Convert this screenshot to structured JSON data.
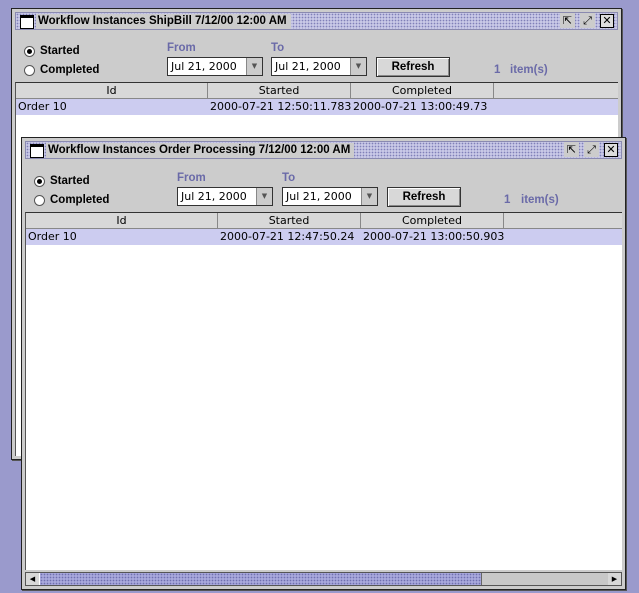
{
  "back_window": {
    "title": "Workflow Instances ShipBill 7/12/00 12:00 AM",
    "radio_started": "Started",
    "radio_completed": "Completed",
    "selected_radio": "Started",
    "from_label": "From",
    "to_label": "To",
    "from_value": "Jul 21, 2000",
    "to_value": "Jul 21, 2000",
    "refresh_label": "Refresh",
    "count": "1",
    "items_label": "item(s)",
    "columns": [
      "Id",
      "Started",
      "Completed"
    ],
    "rows": [
      {
        "id": "Order 10",
        "started": "2000-07-21 12:50:11.783",
        "completed": "2000-07-21 13:00:49.73"
      }
    ]
  },
  "front_window": {
    "title": "Workflow Instances Order Processing 7/12/00 12:00 AM",
    "radio_started": "Started",
    "radio_completed": "Completed",
    "selected_radio": "Started",
    "from_label": "From",
    "to_label": "To",
    "from_value": "Jul 21, 2000",
    "to_value": "Jul 21, 2000",
    "refresh_label": "Refresh",
    "count": "1",
    "items_label": "item(s)",
    "columns": [
      "Id",
      "Started",
      "Completed"
    ],
    "rows": [
      {
        "id": "Order 10",
        "started": "2000-07-21 12:47:50.24",
        "completed": "2000-07-21 13:00:50.903"
      }
    ]
  },
  "icons": {
    "iconify": "⇱",
    "maximize": "⤢",
    "close": "✕",
    "combo_arrow": "▼",
    "scroll_left": "◀",
    "scroll_right": "▶"
  },
  "colors": {
    "desktop": "#9a9acc",
    "selection_row": "#ccccf0",
    "label_accent": "#6a6aa8"
  }
}
